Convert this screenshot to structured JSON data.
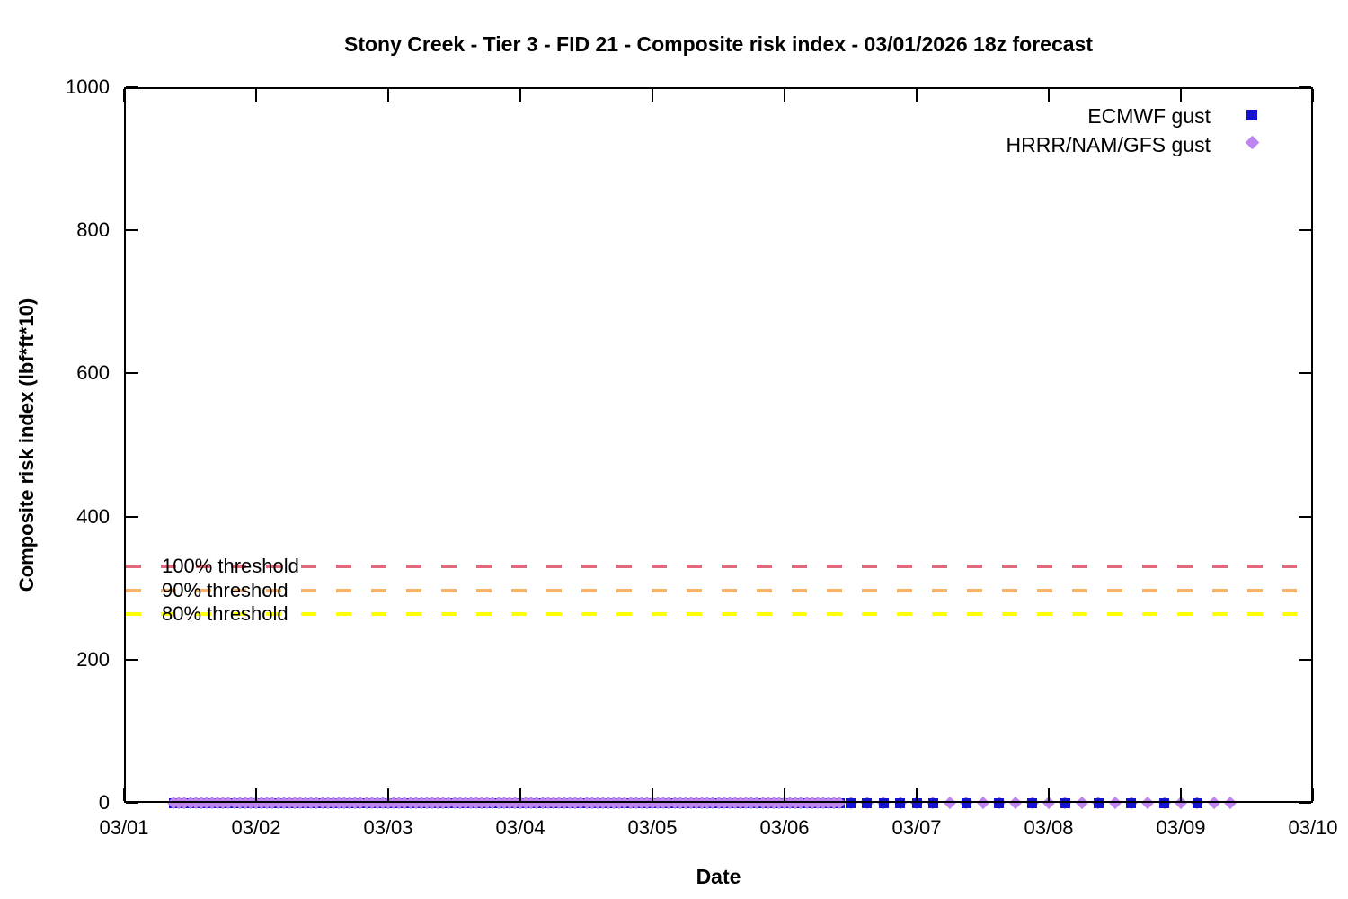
{
  "title": "Stony Creek - Tier 3 - FID 21 - Composite risk index - 03/01/2026 18z forecast",
  "chart_data": {
    "type": "scatter",
    "title": "Stony Creek - Tier 3 - FID 21 - Composite risk index - 03/01/2026 18z forecast",
    "xlabel": "Date",
    "ylabel": "Composite risk index (lbf*ft*10)",
    "x_axis": {
      "tick_labels": [
        "03/01",
        "03/02",
        "03/03",
        "03/04",
        "03/05",
        "03/06",
        "03/07",
        "03/08",
        "03/09",
        "03/10"
      ],
      "span_days": 9
    },
    "y_axis": {
      "min": 0,
      "max": 1000,
      "ticks": [
        0,
        200,
        400,
        600,
        800,
        1000
      ]
    },
    "grid": "off",
    "legend_position": "top-right-inside",
    "series": [
      {
        "name": "ECMWF gust",
        "marker": "square",
        "color": "#1212cf",
        "value": 0,
        "segments_hours_from_0301_00z": [
          {
            "start_hours": 9,
            "end_hours": 130,
            "step_hours": 1
          },
          {
            "start_hours": 132,
            "end_hours": 147,
            "step_hours": 3
          },
          {
            "start_hours": 153,
            "end_hours": 195,
            "step_hours": 6
          }
        ]
      },
      {
        "name": "HRRR/NAM/GFS gust",
        "marker": "diamond",
        "color": "#be85f0",
        "value": 0,
        "segments_hours_from_0301_00z": [
          {
            "start_hours": 9,
            "end_hours": 130,
            "step_hours": 1
          },
          {
            "start_hours": 132,
            "end_hours": 201,
            "step_hours": 3
          }
        ]
      }
    ],
    "thresholds": [
      {
        "label": "100% threshold",
        "value": 330,
        "color": "#e2687d"
      },
      {
        "label": "90% threshold",
        "value": 297,
        "color": "#f6b26b"
      },
      {
        "label": "80% threshold",
        "value": 264,
        "color": "#ffff00"
      }
    ]
  }
}
